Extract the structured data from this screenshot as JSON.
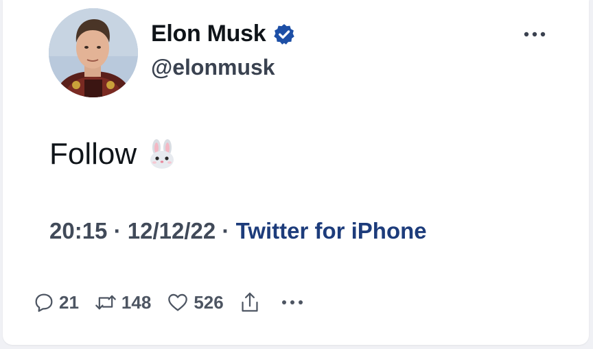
{
  "author": {
    "display_name": "Elon Musk",
    "handle": "@elonmusk",
    "verified": true,
    "verified_color": "#1d4fa6",
    "avatar_icon": "profile-photo"
  },
  "tweet": {
    "text": "Follow",
    "emoji": "rabbit-face"
  },
  "meta": {
    "time": "20:15",
    "separator": "·",
    "date": "12/12/22",
    "source": "Twitter for iPhone"
  },
  "actions": {
    "replies": "21",
    "retweets": "148",
    "likes": "526"
  },
  "colors": {
    "text_primary": "#0f1419",
    "text_secondary": "#414a59",
    "link": "#1d3c7b",
    "card_background": "#ffffff",
    "page_background": "#f0f1f5"
  },
  "icons": {
    "reply": "reply-icon",
    "retweet": "retweet-icon",
    "like": "heart-icon",
    "share": "share-icon",
    "more": "more-icon"
  }
}
